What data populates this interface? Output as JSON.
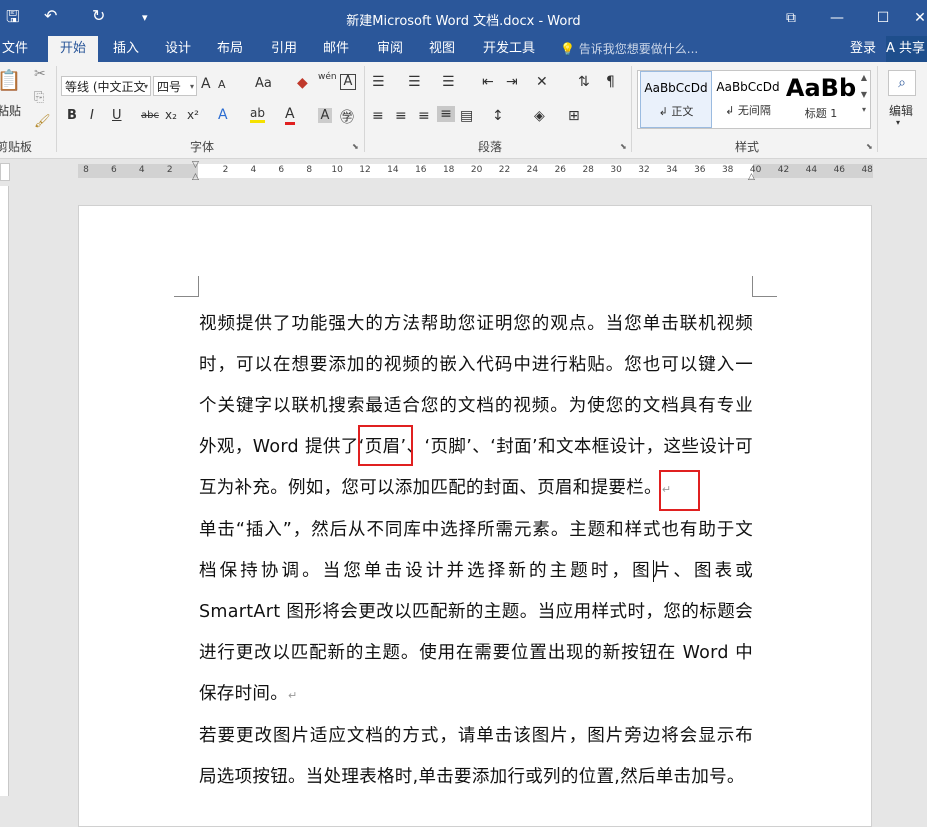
{
  "app": {
    "title": "新建Microsoft Word 文档.docx - Word",
    "minimize": "—",
    "restore": "⧉",
    "close": "✕"
  },
  "qat": {
    "save": "🖫",
    "undo": "↶",
    "redo": "↻",
    "customize": "▾"
  },
  "tabs": [
    {
      "label": "文件"
    },
    {
      "label": "开始"
    },
    {
      "label": "插入"
    },
    {
      "label": "设计"
    },
    {
      "label": "布局"
    },
    {
      "label": "引用"
    },
    {
      "label": "邮件"
    },
    {
      "label": "审阅"
    },
    {
      "label": "视图"
    },
    {
      "label": "开发工具"
    }
  ],
  "tellme": "💡 告诉我您想要做什么...",
  "account": {
    "login": "登录",
    "share": "A 共享"
  },
  "ribbon": {
    "clipboard": {
      "paste": "粘贴",
      "label": "剪贴板"
    },
    "font": {
      "name": "等线 (中文正文",
      "size": "四号",
      "grow": "A",
      "shrink": "A",
      "case": "Aa",
      "bold": "B",
      "italic": "I",
      "underline": "U",
      "strike": "abc",
      "sub": "x₂",
      "sup": "x²",
      "label": "字体",
      "phonetic": "wén",
      "border_char": "A"
    },
    "paragraph": {
      "label": "段落"
    },
    "styles": {
      "items": [
        {
          "preview": "AaBbCcDd",
          "name": "↲ 正文"
        },
        {
          "preview": "AaBbCcDd",
          "name": "↲ 无间隔"
        },
        {
          "preview": "AaBb",
          "name": "标题 1"
        }
      ],
      "label": "样式"
    },
    "editing": {
      "label": "编辑"
    }
  },
  "ruler_ticks": [
    "8",
    "6",
    "4",
    "2",
    "",
    "2",
    "4",
    "6",
    "8",
    "10",
    "12",
    "14",
    "16",
    "18",
    "20",
    "22",
    "24",
    "26",
    "28",
    "30",
    "32",
    "34",
    "36",
    "38",
    "40",
    "42",
    "44",
    "46",
    "48"
  ],
  "document": {
    "lines": [
      "视频提供了功能强大的方法帮助您证明您的观点。当您单击联机视频",
      "时，可以在想要添加的视频的嵌入代码中进行粘贴。您也可以键入一",
      "个关键字以联机搜索最适合您的文档的视频。为使您的文档具有专业",
      "外观，Word 提供了‘页眉’、‘页脚’、‘封面’和文本框设计，这些设计可",
      "互为补充。例如，您可以添加匹配的封面、页眉和提要栏。",
      "单击“插入”，然后从不同库中选择所需元素。主题和样式也有助于文",
      "档保持协调。当您单击设计并选择新的主题时，图片、图表或",
      "SmartArt 图形将会更改以匹配新的主题。当应用样式时，您的标题会",
      "进行更改以匹配新的主题。使用在需要位置出现的新按钮在 Word",
      "中保存时间。",
      "若要更改图片适应文档的方式，请单击该图片，图片旁边将会显示布",
      "局选项按钮。当处理表格时,单击要添加行或列的位置,然后单击加号。"
    ],
    "para_mark": "↵"
  }
}
